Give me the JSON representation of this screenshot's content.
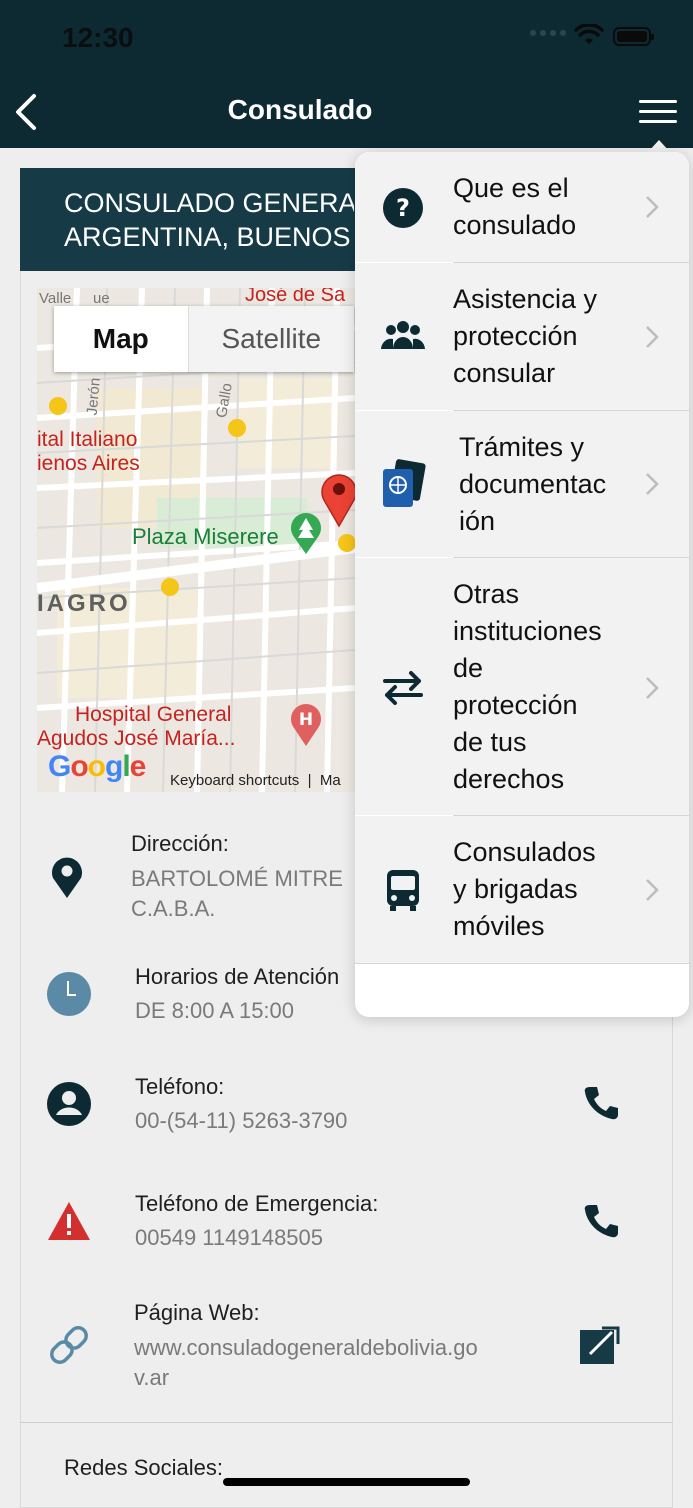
{
  "status": {
    "time": "12:30"
  },
  "nav": {
    "title": "Consulado"
  },
  "header": {
    "line1": "CONSULADO GENERAL",
    "line2": "ARGENTINA, BUENOS"
  },
  "map": {
    "tab_map": "Map",
    "tab_satellite": "Satellite",
    "labels": {
      "hospital_italiano_1": "ital Italiano",
      "hospital_italiano_2": "ienos Aires",
      "plaza": "Plaza Miserere",
      "agro": "IAGRO",
      "hospital_general_1": "Hospital General",
      "hospital_general_2": "Agudos José María...",
      "street_jose": "José de Sa",
      "street_gallo": "Gallo",
      "street_jeron": "Jerón",
      "street_valle": "Valle",
      "street_que": "ue"
    },
    "google": "Google",
    "keyboard": "Keyboard shortcuts",
    "ma": "Ma"
  },
  "info": {
    "direccion_label": "Dirección:",
    "direccion_value_1": "BARTOLOMÉ MITRE",
    "direccion_value_2": "C.A.B.A.",
    "horarios_label": "Horarios de Atención",
    "horarios_value": "DE 8:00 A 15:00",
    "telefono_label": "Teléfono:",
    "telefono_value": "00-(54-11) 5263-3790",
    "emergencia_label": "Teléfono de Emergencia:",
    "emergencia_value": "00549 1149148505",
    "web_label": "Página Web:",
    "web_value_1": "www.consuladogeneraldebolivia.go",
    "web_value_2": "v.ar",
    "social_label": "Redes Sociales:"
  },
  "menu": {
    "items": [
      {
        "lines": [
          "Que es el",
          "consulado"
        ],
        "icon": "question-circle-icon"
      },
      {
        "lines": [
          "Asistencia y",
          "protección",
          "consular"
        ],
        "icon": "people-group-icon"
      },
      {
        "lines": [
          "Trámites y",
          "documentac",
          "ión"
        ],
        "icon": "passport-icon"
      },
      {
        "lines": [
          "Otras",
          "instituciones",
          "de",
          "protección",
          "de tus",
          "derechos"
        ],
        "icon": "swap-arrows-icon"
      },
      {
        "lines": [
          "Consulados",
          "y brigadas",
          "móviles"
        ],
        "icon": "bus-icon"
      }
    ]
  },
  "colors": {
    "primary": "#0d2a33",
    "header": "#163b47",
    "accent_red": "#d32f2f",
    "clock": "#5a8aa6"
  }
}
